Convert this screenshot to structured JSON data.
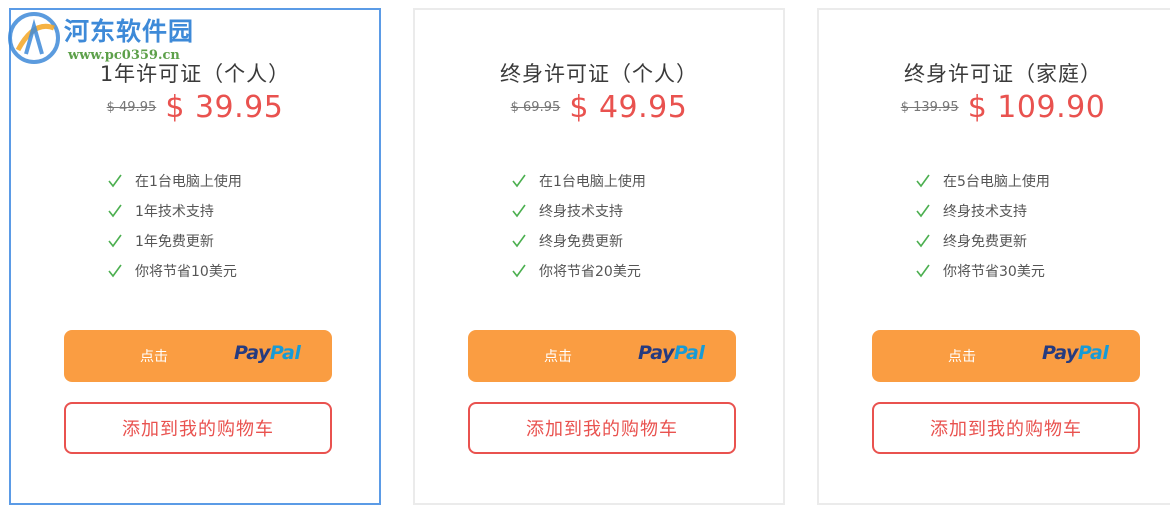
{
  "watermark": {
    "title": "河东软件园",
    "url": "www.pc0359.cn"
  },
  "plans": [
    {
      "title": "1年许可证（个人）",
      "old_price": "$ 49.95",
      "price": "$ 39.95",
      "selected": true,
      "features": [
        "在1台电脑上使用",
        "1年技术支持",
        "1年免费更新",
        "你将节省10美元"
      ],
      "buy_label": "点击",
      "cart_label": "添加到我的购物车"
    },
    {
      "title": "终身许可证（个人）",
      "old_price": "$ 69.95",
      "price": "$ 49.95",
      "selected": false,
      "features": [
        "在1台电脑上使用",
        "终身技术支持",
        "终身免费更新",
        "你将节省20美元"
      ],
      "buy_label": "点击",
      "cart_label": "添加到我的购物车"
    },
    {
      "title": "终身许可证（家庭）",
      "old_price": "$ 139.95",
      "price": "$ 109.90",
      "selected": false,
      "features": [
        "在5台电脑上使用",
        "终身技术支持",
        "终身免费更新",
        "你将节省30美元"
      ],
      "buy_label": "点击",
      "cart_label": "添加到我的购物车"
    }
  ],
  "paypal_logo": {
    "part1": "Pay",
    "part2": "Pal"
  },
  "colors": {
    "accent_orange": "#fa9d42",
    "price_red": "#e9524f",
    "check_green": "#4caf50",
    "selected_border": "#5b9be6",
    "paypal_dark": "#253b80",
    "paypal_light": "#179bd7"
  },
  "icons": {
    "feature": "check-icon",
    "watermark": "site-logo-icon"
  }
}
